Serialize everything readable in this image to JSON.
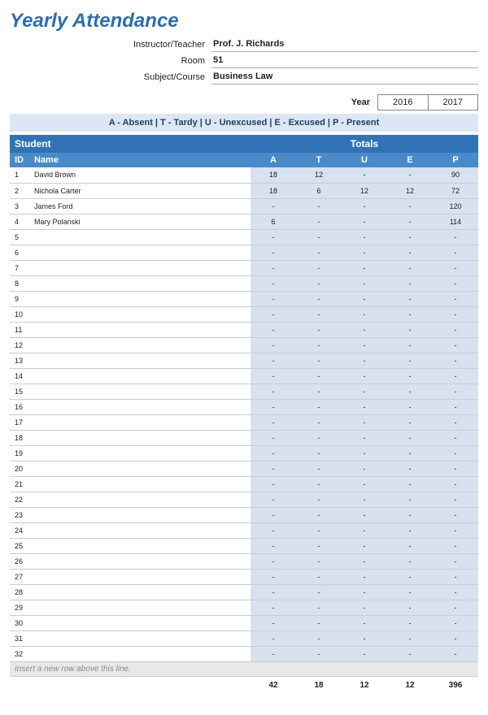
{
  "title": "Yearly Attendance",
  "fields": {
    "instructor_label": "Instructor/Teacher",
    "instructor_value": "Prof. J. Richards",
    "room_label": "Room",
    "room_value": "51",
    "subject_label": "Subject/Course",
    "subject_value": "Business Law"
  },
  "year": {
    "label": "Year",
    "options": [
      "2016",
      "2017"
    ]
  },
  "legend": "A - Absent  |  T - Tardy  |  U - Unexcused  |  E - Excused  |  P - Present",
  "headers": {
    "student": "Student",
    "totals": "Totals",
    "id": "ID",
    "name": "Name",
    "cols": [
      "A",
      "T",
      "U",
      "E",
      "P"
    ]
  },
  "rows": [
    {
      "id": "1",
      "name": "David Brown",
      "a": "18",
      "t": "12",
      "u": "-",
      "e": "-",
      "p": "90"
    },
    {
      "id": "2",
      "name": "Nichola Carter",
      "a": "18",
      "t": "6",
      "u": "12",
      "e": "12",
      "p": "72"
    },
    {
      "id": "3",
      "name": "James Ford",
      "a": "-",
      "t": "-",
      "u": "-",
      "e": "-",
      "p": "120"
    },
    {
      "id": "4",
      "name": "Mary Polanski",
      "a": "6",
      "t": "-",
      "u": "-",
      "e": "-",
      "p": "114"
    },
    {
      "id": "5",
      "name": "",
      "a": "-",
      "t": "-",
      "u": "-",
      "e": "-",
      "p": "-"
    },
    {
      "id": "6",
      "name": "",
      "a": "-",
      "t": "-",
      "u": "-",
      "e": "-",
      "p": "-"
    },
    {
      "id": "7",
      "name": "",
      "a": "-",
      "t": "-",
      "u": "-",
      "e": "-",
      "p": "-"
    },
    {
      "id": "8",
      "name": "",
      "a": "-",
      "t": "-",
      "u": "-",
      "e": "-",
      "p": "-"
    },
    {
      "id": "9",
      "name": "",
      "a": "-",
      "t": "-",
      "u": "-",
      "e": "-",
      "p": "-"
    },
    {
      "id": "10",
      "name": "",
      "a": "-",
      "t": "-",
      "u": "-",
      "e": "-",
      "p": "-"
    },
    {
      "id": "11",
      "name": "",
      "a": "-",
      "t": "-",
      "u": "-",
      "e": "-",
      "p": "-"
    },
    {
      "id": "12",
      "name": "",
      "a": "-",
      "t": "-",
      "u": "-",
      "e": "-",
      "p": "-"
    },
    {
      "id": "13",
      "name": "",
      "a": "-",
      "t": "-",
      "u": "-",
      "e": "-",
      "p": "-"
    },
    {
      "id": "14",
      "name": "",
      "a": "-",
      "t": "-",
      "u": "-",
      "e": "-",
      "p": "-"
    },
    {
      "id": "15",
      "name": "",
      "a": "-",
      "t": "-",
      "u": "-",
      "e": "-",
      "p": "-"
    },
    {
      "id": "16",
      "name": "",
      "a": "-",
      "t": "-",
      "u": "-",
      "e": "-",
      "p": "-"
    },
    {
      "id": "17",
      "name": "",
      "a": "-",
      "t": "-",
      "u": "-",
      "e": "-",
      "p": "-"
    },
    {
      "id": "18",
      "name": "",
      "a": "-",
      "t": "-",
      "u": "-",
      "e": "-",
      "p": "-"
    },
    {
      "id": "19",
      "name": "",
      "a": "-",
      "t": "-",
      "u": "-",
      "e": "-",
      "p": "-"
    },
    {
      "id": "20",
      "name": "",
      "a": "-",
      "t": "-",
      "u": "-",
      "e": "-",
      "p": "-"
    },
    {
      "id": "21",
      "name": "",
      "a": "-",
      "t": "-",
      "u": "-",
      "e": "-",
      "p": "-"
    },
    {
      "id": "22",
      "name": "",
      "a": "-",
      "t": "-",
      "u": "-",
      "e": "-",
      "p": "-"
    },
    {
      "id": "23",
      "name": "",
      "a": "-",
      "t": "-",
      "u": "-",
      "e": "-",
      "p": "-"
    },
    {
      "id": "24",
      "name": "",
      "a": "-",
      "t": "-",
      "u": "-",
      "e": "-",
      "p": "-"
    },
    {
      "id": "25",
      "name": "",
      "a": "-",
      "t": "-",
      "u": "-",
      "e": "-",
      "p": "-"
    },
    {
      "id": "26",
      "name": "",
      "a": "-",
      "t": "-",
      "u": "-",
      "e": "-",
      "p": "-"
    },
    {
      "id": "27",
      "name": "",
      "a": "-",
      "t": "-",
      "u": "-",
      "e": "-",
      "p": "-"
    },
    {
      "id": "28",
      "name": "",
      "a": "-",
      "t": "-",
      "u": "-",
      "e": "-",
      "p": "-"
    },
    {
      "id": "29",
      "name": "",
      "a": "-",
      "t": "-",
      "u": "-",
      "e": "-",
      "p": "-"
    },
    {
      "id": "30",
      "name": "",
      "a": "-",
      "t": "-",
      "u": "-",
      "e": "-",
      "p": "-"
    },
    {
      "id": "31",
      "name": "",
      "a": "-",
      "t": "-",
      "u": "-",
      "e": "-",
      "p": "-"
    },
    {
      "id": "32",
      "name": "",
      "a": "-",
      "t": "-",
      "u": "-",
      "e": "-",
      "p": "-"
    }
  ],
  "insert_hint": "Insert a new row above this line.",
  "totals": {
    "a": "42",
    "t": "18",
    "u": "12",
    "e": "12",
    "p": "396"
  }
}
